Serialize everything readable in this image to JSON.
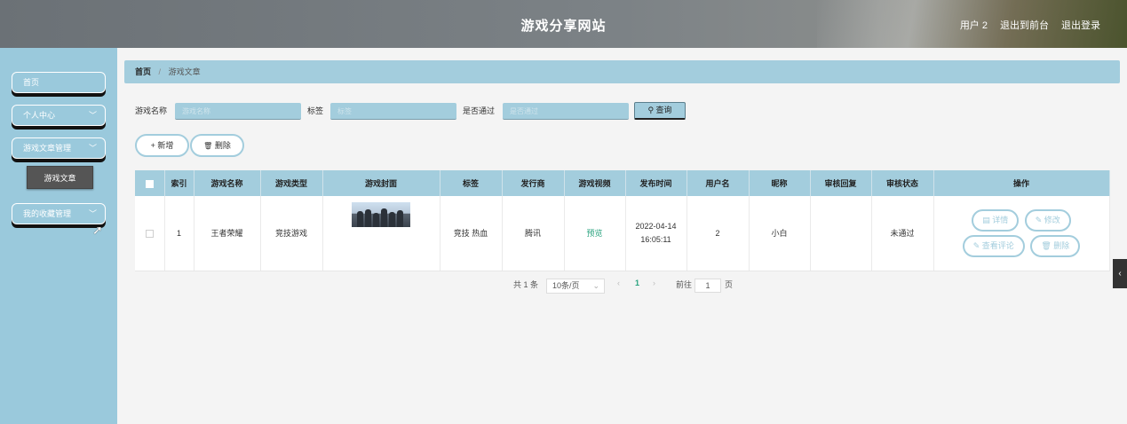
{
  "header": {
    "title": "游戏分享网站",
    "user": "用户 2",
    "to_front": "退出到前台",
    "logout": "退出登录"
  },
  "sidebar": {
    "items": [
      {
        "label": "首页"
      },
      {
        "label": "个人中心",
        "chevron": "﹀"
      },
      {
        "label": "游戏文章管理",
        "chevron": "﹀"
      },
      {
        "label": "我的收藏管理",
        "chevron": "﹀"
      }
    ],
    "sub_item": "游戏文章"
  },
  "breadcrumb": {
    "home": "首页",
    "sep": "/",
    "current": "游戏文章"
  },
  "search": {
    "name_label": "游戏名称",
    "name_placeholder": "游戏名称",
    "tag_label": "标签",
    "tag_placeholder": "标签",
    "pass_label": "是否通过",
    "pass_placeholder": "是否通过",
    "query_btn": "查询",
    "search_icon": "⚲"
  },
  "actions": {
    "add": "新增",
    "add_icon": "+",
    "delete": "删除",
    "delete_icon": "🗑"
  },
  "table": {
    "headers": [
      "",
      "索引",
      "游戏名称",
      "游戏类型",
      "游戏封面",
      "标签",
      "发行商",
      "游戏视频",
      "发布时间",
      "用户名",
      "昵称",
      "审核回复",
      "审核状态",
      "操作"
    ],
    "rows": [
      {
        "index": "1",
        "name": "王者荣耀",
        "type": "竞技游戏",
        "tags": "竞技 热血",
        "publisher": "腾讯",
        "video": "预览",
        "time_date": "2022-04-14",
        "time_clock": "16:05:11",
        "username": "2",
        "nickname": "小白",
        "reply": "",
        "status": "未通过",
        "ops": {
          "detail": "详情",
          "edit": "修改",
          "comments": "查看评论",
          "delete": "删除"
        }
      }
    ]
  },
  "pagination": {
    "total": "共 1 条",
    "page_size": "10条/页",
    "prev": "‹",
    "page": "1",
    "next": "›",
    "goto": "前往",
    "goto_value": "1",
    "page_unit": "页"
  },
  "side_tab": "‹",
  "colors": {
    "accent": "#a3cddd",
    "sidebar": "#9ac9dc",
    "link_green": "#2aa37f"
  }
}
